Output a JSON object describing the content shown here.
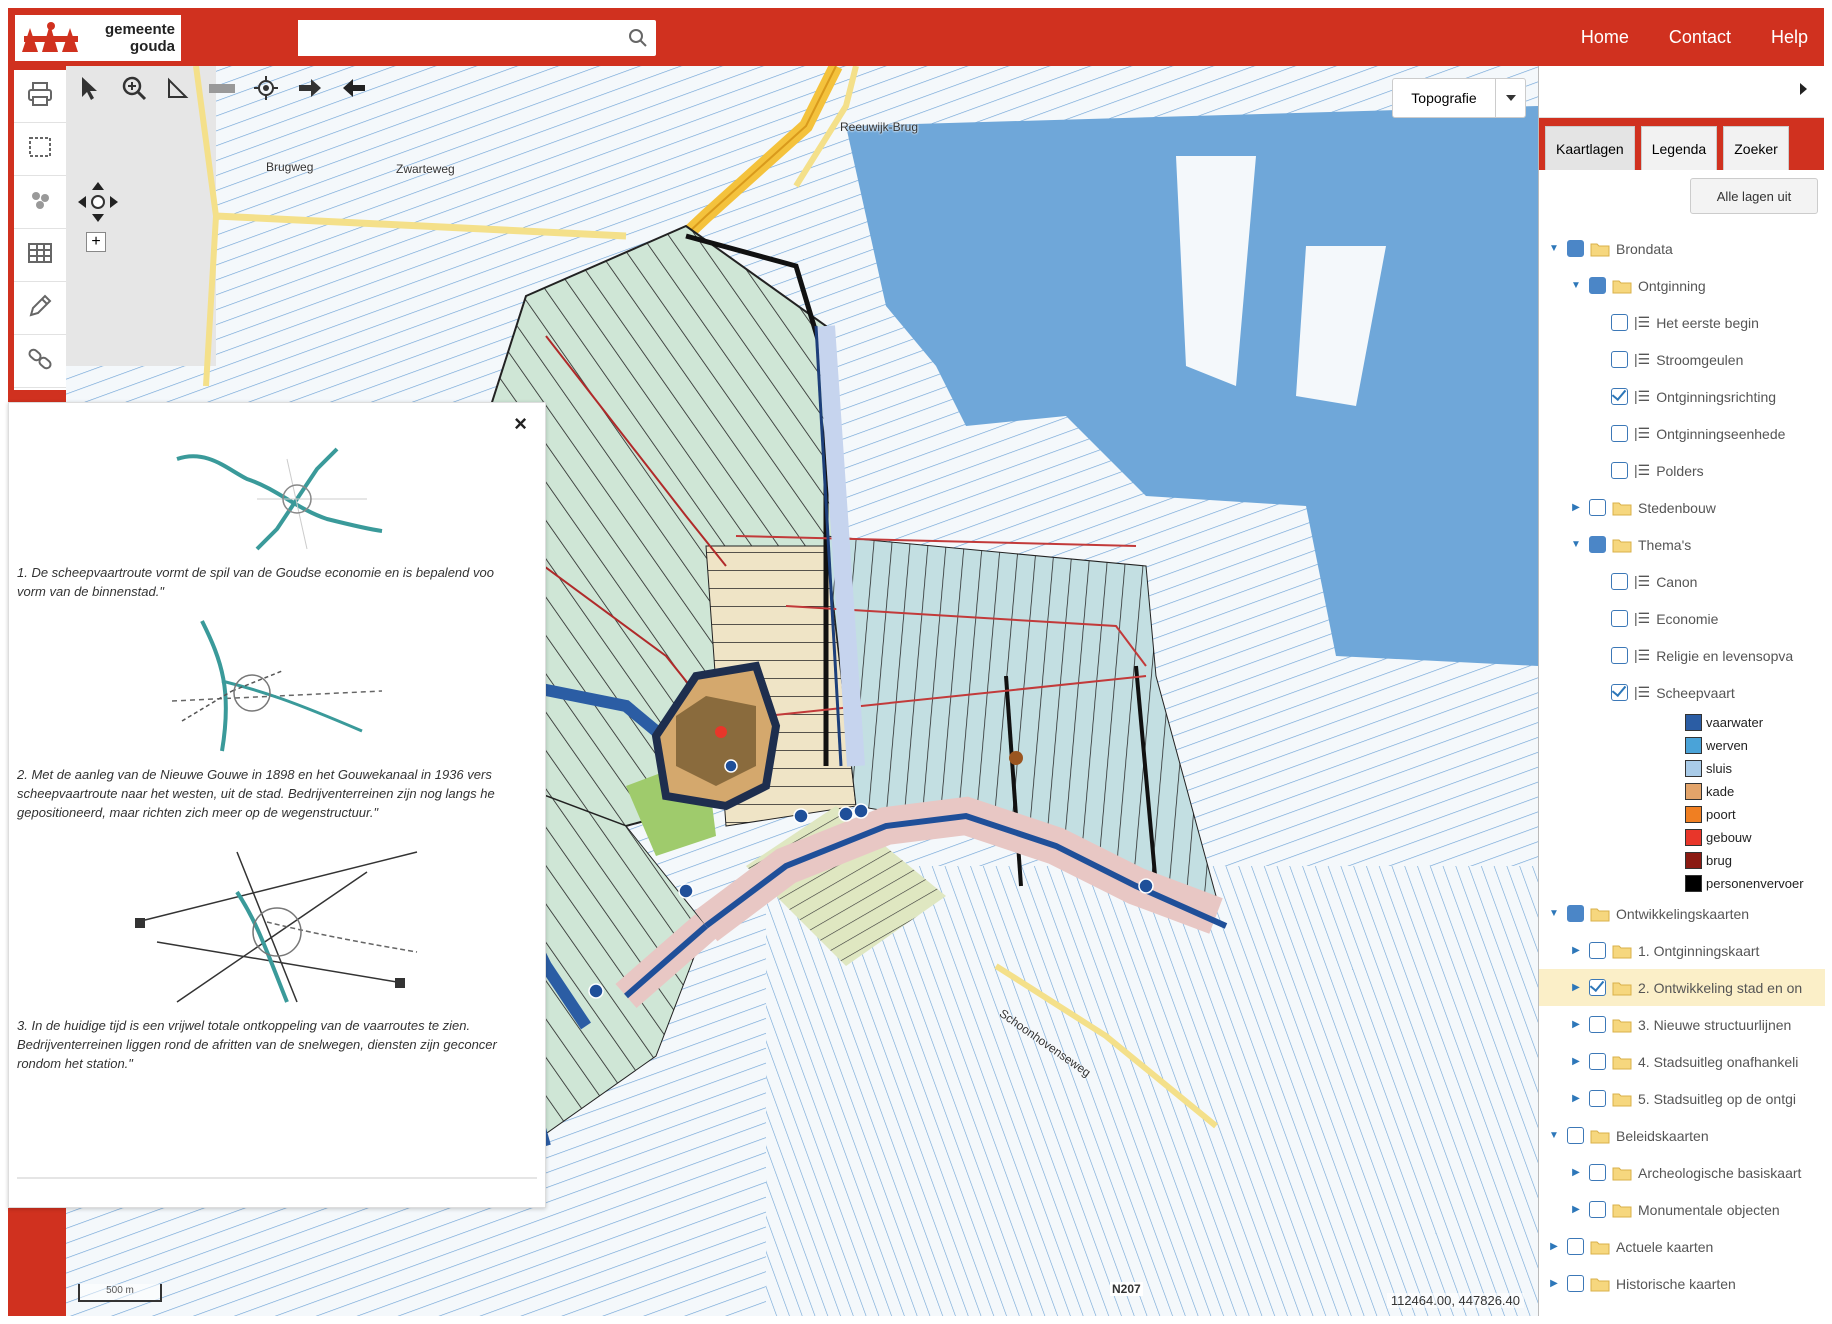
{
  "header": {
    "logo_text_line1": "gemeente",
    "logo_text_line2": "gouda",
    "search_placeholder": "",
    "nav": [
      "Home",
      "Contact",
      "Help"
    ]
  },
  "colors": {
    "brand_red": "#d0311f",
    "water_blue": "#6fa7d9",
    "highlight_row": "#fbefc8"
  },
  "left_toolbar": {
    "icons": [
      "print-icon",
      "select-rectangle-icon",
      "cluster-icon",
      "table-icon",
      "edit-icon",
      "link-icon"
    ]
  },
  "map": {
    "tools": [
      "pointer-icon",
      "zoom-icon",
      "measure-icon",
      "ruler-icon",
      "locate-icon",
      "forward-icon",
      "back-icon"
    ],
    "basemap_label": "Topografie",
    "coordinates": "112464.00, 447826.40",
    "scale_label": "500 m",
    "labels": {
      "brugweg": "Brugweg",
      "zwarteweg": "Zwarteweg",
      "reeuwijk_brug": "Reeuwijk-Brug",
      "schoonhovenseweg": "Schoonhovenseweg",
      "n207": "N207"
    }
  },
  "popup": {
    "close_symbol": "×",
    "paragraphs": [
      "1. De scheepvaartroute vormt de spil van de Goudse economie en is bepalend voo",
      "vorm van de binnenstad.\"",
      "2. Met de aanleg van de Nieuwe Gouwe in 1898 en het Gouwekanaal in 1936 vers",
      "scheepvaartroute naar het westen, uit de stad. Bedrijventerreinen zijn nog langs he",
      "gepositioneerd, maar richten zich meer op de wegenstructuur.\"",
      "3. In de huidige tijd is een vrijwel totale ontkoppeling van de vaarroutes te zien.",
      "Bedrijventerreinen liggen rond de afritten van de snelwegen, diensten zijn geconcer",
      "rondom het station.\""
    ]
  },
  "sidebar": {
    "tabs": [
      "Kaartlagen",
      "Legenda",
      "Zoeker"
    ],
    "all_layers_off": "Alle lagen uit",
    "tree": [
      {
        "label": "Brondata",
        "level": 0,
        "expanded": true,
        "state": "filled",
        "type": "folder"
      },
      {
        "label": "Ontginning",
        "level": 1,
        "expanded": true,
        "state": "filled",
        "type": "folder"
      },
      {
        "label": "Het eerste begin",
        "level": 2,
        "state": "empty",
        "type": "layer"
      },
      {
        "label": "Stroomgeulen",
        "level": 2,
        "state": "empty",
        "type": "layer"
      },
      {
        "label": "Ontginningsrichting",
        "level": 2,
        "state": "checked",
        "type": "layer"
      },
      {
        "label": "Ontginningseenhede",
        "level": 2,
        "state": "empty",
        "type": "layer"
      },
      {
        "label": "Polders",
        "level": 2,
        "state": "empty",
        "type": "layer"
      },
      {
        "label": "Stedenbouw",
        "level": 1,
        "expanded": false,
        "state": "empty",
        "type": "folder"
      },
      {
        "label": "Thema's",
        "level": 1,
        "expanded": true,
        "state": "filled",
        "type": "folder"
      },
      {
        "label": "Canon",
        "level": 2,
        "state": "empty",
        "type": "layer"
      },
      {
        "label": "Economie",
        "level": 2,
        "state": "empty",
        "type": "layer"
      },
      {
        "label": "Religie en levensopva",
        "level": 2,
        "state": "empty",
        "type": "layer"
      },
      {
        "label": "Scheepvaart",
        "level": 2,
        "state": "checked",
        "type": "layer"
      }
    ],
    "legend": [
      {
        "label": "vaarwater",
        "color": "#2b5da4"
      },
      {
        "label": "werven",
        "color": "#4aa3d8"
      },
      {
        "label": "sluis",
        "color": "#a9cbe8"
      },
      {
        "label": "kade",
        "color": "#e3a46a"
      },
      {
        "label": "poort",
        "color": "#f07f22"
      },
      {
        "label": "gebouw",
        "color": "#e8362a"
      },
      {
        "label": "brug",
        "color": "#8b1a12"
      },
      {
        "label": "personenvervoer",
        "color": "#000000"
      }
    ],
    "tree2": [
      {
        "label": "Ontwikkelingskaarten",
        "level": 0,
        "expanded": true,
        "state": "filled",
        "type": "folder"
      },
      {
        "label": "1. Ontginningskaart",
        "level": 1,
        "expanded": false,
        "state": "empty",
        "type": "folder"
      },
      {
        "label": "2. Ontwikkeling stad en on",
        "level": 1,
        "expanded": false,
        "state": "checked",
        "type": "folder",
        "highlight": true
      },
      {
        "label": "3. Nieuwe structuurlijnen",
        "level": 1,
        "expanded": false,
        "state": "empty",
        "type": "folder"
      },
      {
        "label": "4. Stadsuitleg onafhankeli",
        "level": 1,
        "expanded": false,
        "state": "empty",
        "type": "folder"
      },
      {
        "label": "5. Stadsuitleg op de ontgi",
        "level": 1,
        "expanded": false,
        "state": "empty",
        "type": "folder"
      },
      {
        "label": "Beleidskaarten",
        "level": 0,
        "expanded": true,
        "state": "empty",
        "type": "folder"
      },
      {
        "label": "Archeologische basiskaart",
        "level": 1,
        "expanded": false,
        "state": "empty",
        "type": "folder"
      },
      {
        "label": "Monumentale objecten",
        "level": 1,
        "expanded": false,
        "state": "empty",
        "type": "folder"
      },
      {
        "label": "Actuele kaarten",
        "level": 0,
        "expanded": false,
        "state": "empty",
        "type": "folder"
      },
      {
        "label": "Historische kaarten",
        "level": 0,
        "expanded": false,
        "state": "empty",
        "type": "folder"
      }
    ]
  }
}
